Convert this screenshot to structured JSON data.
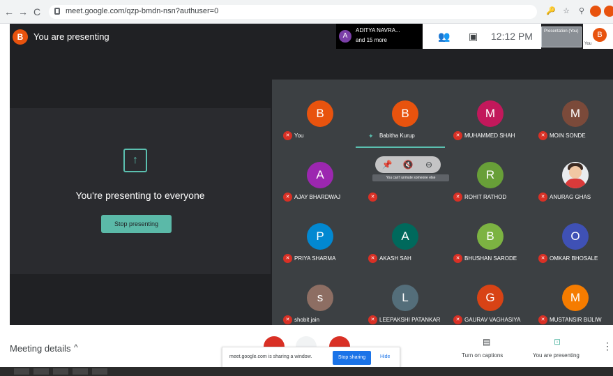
{
  "browser": {
    "back": "←",
    "forward": "→",
    "reload": "C",
    "url": "meet.google.com/qzp-bmdn-nsn?authuser=0",
    "icons": [
      "🔑",
      "☆",
      "⚲",
      "●",
      "●"
    ]
  },
  "meet": {
    "presenter_initial": "B",
    "presenting_title": "You are presenting",
    "participants_chip": {
      "initial": "A",
      "name": "ADITYA NAVRA...",
      "more": "and 15 more"
    },
    "clock": "12:12 PM",
    "presentation_label": "Presentation (You)",
    "you_initial": "B",
    "you_label": "You",
    "present_panel": {
      "icon": "↑",
      "text": "You're presenting to everyone",
      "stop_button": "Stop presenting"
    },
    "tiles": [
      {
        "initial": "B",
        "name": "You",
        "color": "#e8530e",
        "icon": "mic"
      },
      {
        "initial": "B",
        "name": "Babitha Kurup",
        "color": "#e8530e",
        "icon": "dot",
        "speaking": true
      },
      {
        "initial": "M",
        "name": "MUHAMMED SHAH",
        "color": "#c2185b",
        "icon": "mic"
      },
      {
        "initial": "M",
        "name": "MOIN SONDE",
        "color": "#7b4a3a",
        "icon": "mic"
      },
      {
        "initial": "A",
        "name": "AJAY BHARDWAJ",
        "color": "#9c27b0",
        "icon": "mic"
      },
      {
        "initial": "",
        "name": "",
        "color": "#3c4043",
        "icon": "mic",
        "hover": true
      },
      {
        "initial": "R",
        "name": "ROHIT RATHOD",
        "color": "#689f38",
        "icon": "mic"
      },
      {
        "initial": "",
        "name": "ANURAG GHAS",
        "color": "#e9ecef",
        "icon": "mic",
        "photo": true
      },
      {
        "initial": "P",
        "name": "PRIYA SHARMA",
        "color": "#0288d1",
        "icon": "mic"
      },
      {
        "initial": "A",
        "name": "AKASH SAH",
        "color": "#00695c",
        "icon": "mic"
      },
      {
        "initial": "B",
        "name": "BHUSHAN SARODE",
        "color": "#7cb342",
        "icon": "mic"
      },
      {
        "initial": "O",
        "name": "OMKAR BHOSALE",
        "color": "#3f51b5",
        "icon": "mic"
      },
      {
        "initial": "s",
        "name": "shobit jain",
        "color": "#8d6e63",
        "icon": "mic"
      },
      {
        "initial": "L",
        "name": "LEEPAKSHI PATANKAR",
        "color": "#546e7a",
        "icon": "mic"
      },
      {
        "initial": "G",
        "name": "GAURAV VAGHASIYA",
        "color": "#d84315",
        "icon": "mic"
      },
      {
        "initial": "M",
        "name": "MUSTANSIR BIJLIW",
        "color": "#f57c00",
        "icon": "mic"
      }
    ],
    "hovercard": {
      "icons": [
        "📌",
        "🔇",
        "⊖"
      ],
      "tooltip": "You can't unmute someone else"
    }
  },
  "bottom": {
    "meeting_details": "Meeting details",
    "chevron": "^",
    "share_text": "meet.google.com is sharing a window.",
    "stop_sharing": "Stop sharing",
    "hide": "Hide",
    "captions_icon": "▤",
    "captions_label": "Turn on captions",
    "presenting_icon": "⊡",
    "presenting_label": "You are presenting",
    "more": "⋮"
  },
  "colors": {
    "meet_bg": "#202124",
    "accent": "#5bc0b0",
    "mic_off": "#d93025",
    "blue": "#1a73e8"
  }
}
